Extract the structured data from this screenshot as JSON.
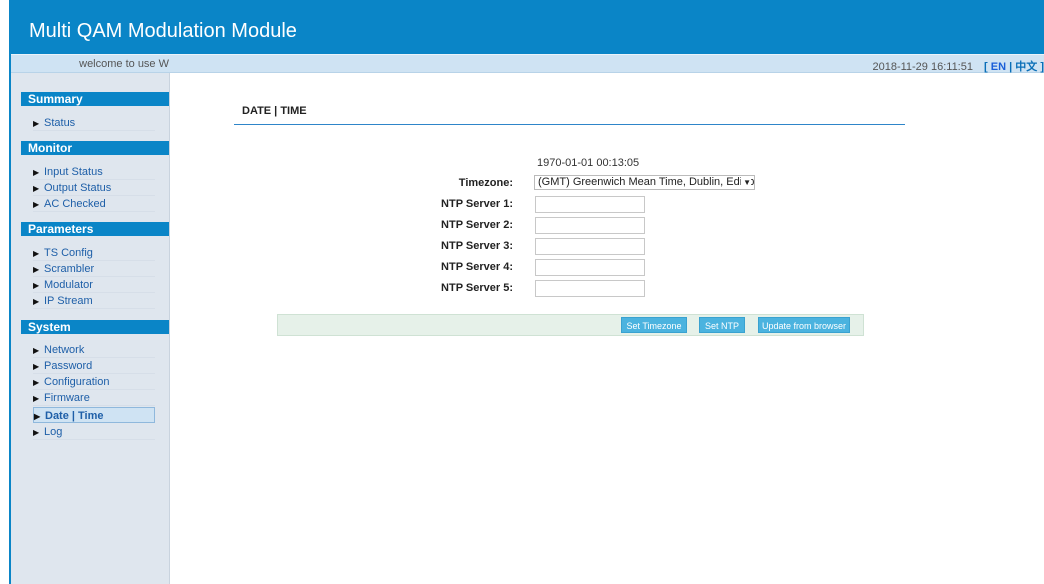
{
  "header": {
    "title": "Multi QAM Modulation Module"
  },
  "subbar": {
    "welcome": "welcome to use W",
    "datetime": "2018-11-29 16:11:51",
    "lang_open": "[",
    "lang_en": "EN",
    "lang_sep": "|",
    "lang_zh": "中文",
    "lang_close": "]"
  },
  "sidebar": {
    "summary": {
      "title": "Summary",
      "items": [
        "Status"
      ]
    },
    "monitor": {
      "title": "Monitor",
      "items": [
        "Input Status",
        "Output Status",
        "AC Checked"
      ]
    },
    "parameters": {
      "title": "Parameters",
      "items": [
        "TS Config",
        "Scrambler",
        "Modulator",
        "IP Stream"
      ]
    },
    "system": {
      "title": "System",
      "items": [
        "Network",
        "Password",
        "Configuration",
        "Firmware",
        "Date | Time",
        "Log"
      ]
    },
    "active_item": "Date | Time"
  },
  "main": {
    "page_title": "DATE | TIME",
    "current_time": "1970-01-01 00:13:05",
    "timezone_label": "Timezone:",
    "timezone_value": "(GMT) Greenwich Mean Time, Dublin, Edinburgh",
    "ntp_servers": [
      {
        "label": "NTP Server 1:",
        "value": ""
      },
      {
        "label": "NTP Server 2:",
        "value": ""
      },
      {
        "label": "NTP Server 3:",
        "value": ""
      },
      {
        "label": "NTP Server 4:",
        "value": ""
      },
      {
        "label": "NTP Server 5:",
        "value": ""
      }
    ],
    "buttons": {
      "set_timezone": "Set Timezone",
      "set_ntp": "Set NTP",
      "update_from_browser": "Update from browser"
    }
  },
  "colors": {
    "header_blue": "#0a85c7",
    "subbar": "#cfe3f3",
    "sidebar_bg": "#dfe6ee",
    "button_blue": "#4bb3df",
    "button_bar_bg": "#e6f1e9"
  },
  "icons": {
    "nav_arrow": "triangle-right-icon",
    "select_caret": "caret-down-icon"
  }
}
